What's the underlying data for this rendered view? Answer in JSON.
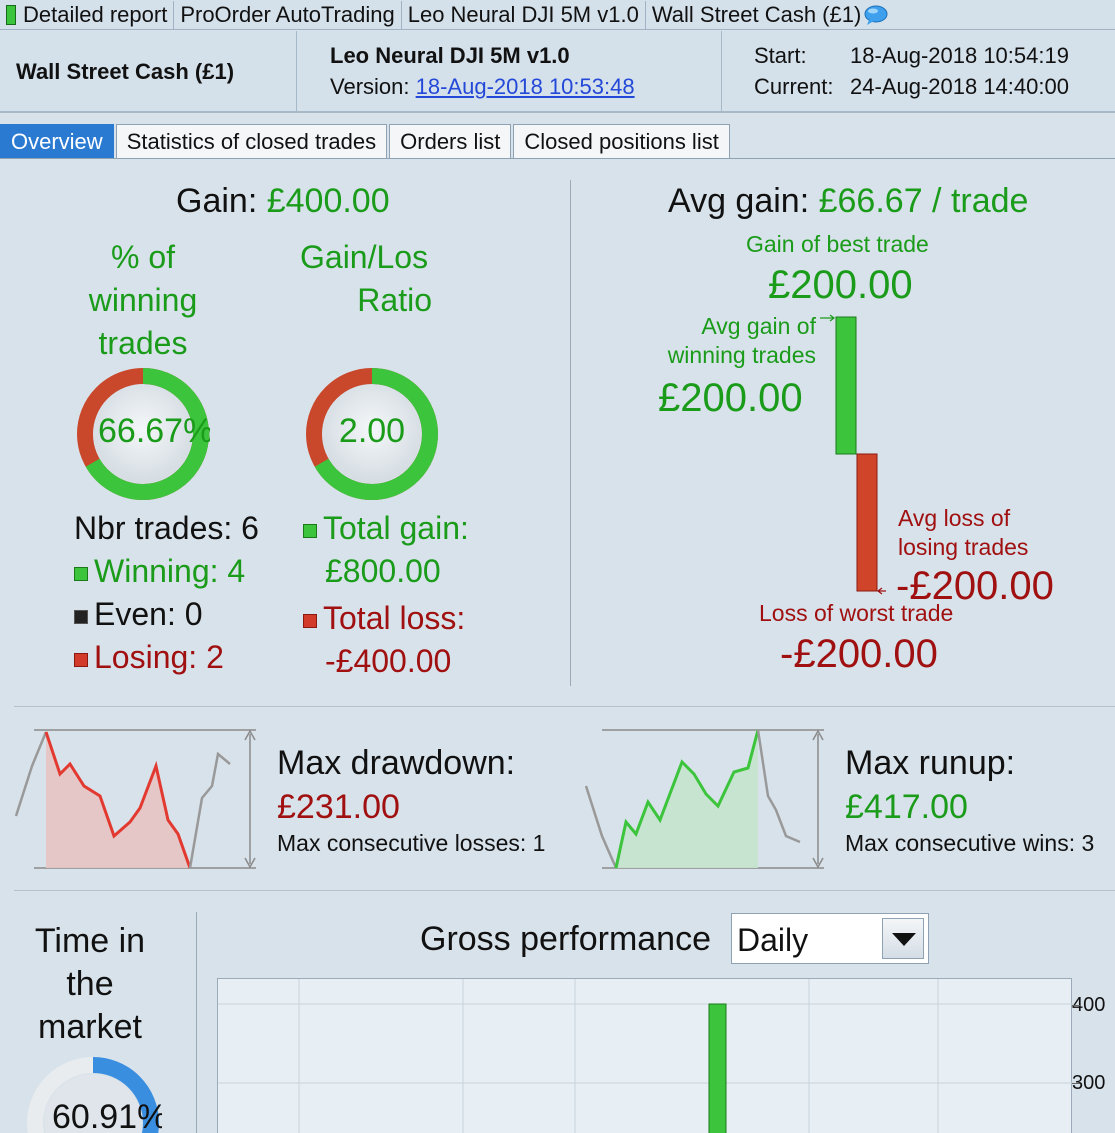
{
  "titlebar": {
    "segments": [
      "Detailed report",
      "ProOrder AutoTrading",
      "Leo Neural DJI 5M v1.0",
      "Wall Street Cash (£1)"
    ]
  },
  "header": {
    "instrument": "Wall Street Cash (£1)",
    "system_name": "Leo Neural DJI 5M v1.0",
    "version_label": "Version:",
    "version_value": "18-Aug-2018 10:53:48",
    "start_label": "Start:",
    "start_value": "18-Aug-2018 10:54:19",
    "current_label": "Current:",
    "current_value": "24-Aug-2018 14:40:00"
  },
  "tabs": [
    {
      "label": "Overview",
      "active": true
    },
    {
      "label": "Statistics of closed trades",
      "active": false
    },
    {
      "label": "Orders list",
      "active": false
    },
    {
      "label": "Closed positions list",
      "active": false
    }
  ],
  "overview": {
    "gain_label": "Gain:",
    "gain_value": "£400.00",
    "pct_winning_label_1": "% of",
    "pct_winning_label_2": "winning",
    "pct_winning_label_3": "trades",
    "pct_winning_value": "66.67%",
    "pct_winning_fraction": 0.6667,
    "gl_ratio_label_1": "Gain/Los",
    "gl_ratio_label_2": "Ratio",
    "gl_ratio_value": "2.00",
    "gl_ratio_fraction": 0.6667,
    "nbr_trades": "Nbr trades: 6",
    "winning": "Winning: 4",
    "even": "Even: 0",
    "losing": "Losing: 2",
    "total_gain_label": "Total gain:",
    "total_gain_value": "£800.00",
    "total_loss_label": "Total loss:",
    "total_loss_value": "-£400.00"
  },
  "avg": {
    "avg_gain_label": "Avg gain:",
    "avg_gain_value": "£66.67 / trade",
    "best_trade_label": "Gain of best trade",
    "best_trade_value": "£200.00",
    "avg_win_label_1": "Avg gain of",
    "avg_win_label_2": "winning trades",
    "avg_win_value": "£200.00",
    "avg_loss_label_1": "Avg loss of",
    "avg_loss_label_2": "losing trades",
    "avg_loss_value": "-£200.00",
    "worst_trade_label": "Loss of worst trade",
    "worst_trade_value": "-£200.00"
  },
  "drawdown": {
    "title": "Max drawdown:",
    "value": "£231.00",
    "consec": "Max consecutive losses: 1"
  },
  "runup": {
    "title": "Max runup:",
    "value": "£417.00",
    "consec": "Max consecutive wins: 3"
  },
  "time_in_market": {
    "label_1": "Time in",
    "label_2": "the",
    "label_3": "market",
    "value": "60.91%",
    "fraction": 0.6091
  },
  "gross_perf": {
    "title": "Gross performance",
    "period": "Daily",
    "tick_400": "400",
    "tick_300": "300"
  },
  "colors": {
    "green": "#1a9b1a",
    "red": "#a01010",
    "tab_active": "#2a7ad2",
    "link": "#2448d8"
  }
}
